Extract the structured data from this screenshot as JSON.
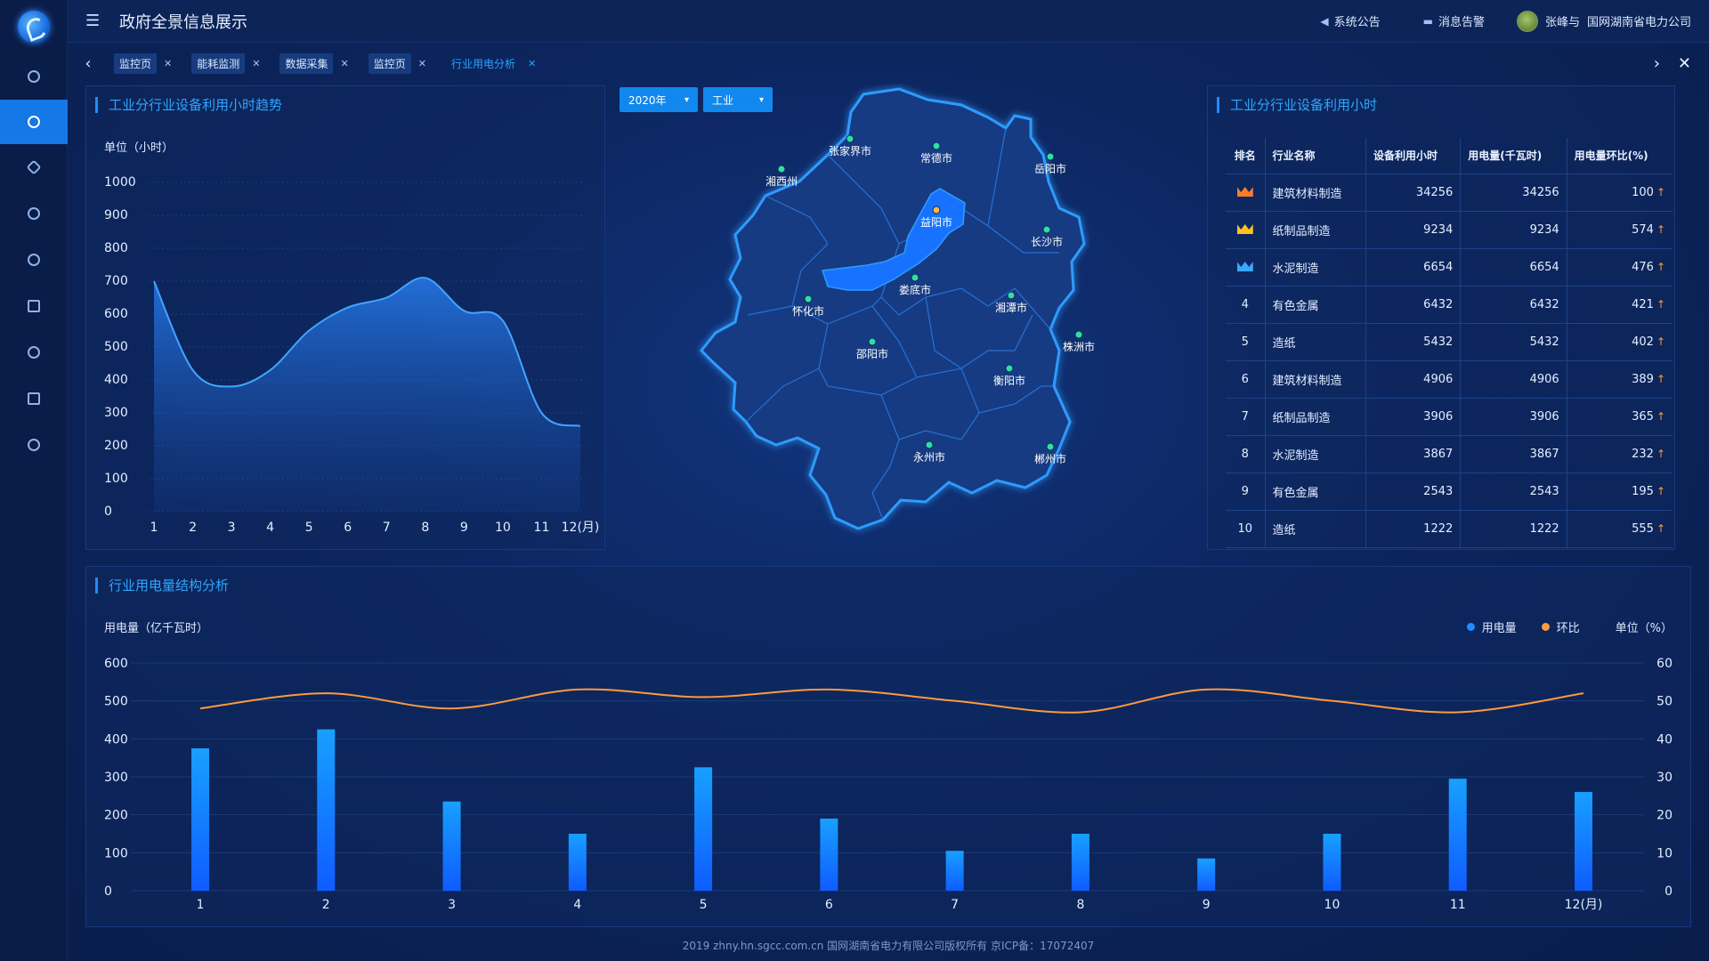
{
  "header": {
    "title": "政府全景信息展示",
    "announcement": "系统公告",
    "alerts": "消息告警",
    "user": "张峰与",
    "company": "国网湖南省电力公司"
  },
  "tabs": [
    {
      "label": "监控页"
    },
    {
      "label": "能耗监测"
    },
    {
      "label": "数据采集"
    },
    {
      "label": "监控页"
    },
    {
      "label": "行业用电分析",
      "active": true
    }
  ],
  "trend_panel": {
    "title": "工业分行业设备利用小时趋势",
    "unit": "单位（小时）"
  },
  "filters": {
    "year": "2020年",
    "industry": "工业"
  },
  "map": {
    "cities": [
      "张家界市",
      "常德市",
      "岳阳市",
      "湘西州",
      "益阳市",
      "长沙市",
      "娄底市",
      "湘潭市",
      "怀化市",
      "株洲市",
      "邵阳市",
      "衡阳市",
      "永州市",
      "郴州市"
    ],
    "highlighted": "益阳市"
  },
  "rank_panel": {
    "title": "工业分行业设备利用小时",
    "columns": [
      "排名",
      "行业名称",
      "设备利用小时",
      "用电量(千瓦时)",
      "用电量环比(%)"
    ],
    "rows": [
      {
        "rank": "1",
        "name": "建筑材料制造",
        "hours": "34256",
        "power": "34256",
        "ratio": "100"
      },
      {
        "rank": "2",
        "name": "纸制品制造",
        "hours": "9234",
        "power": "9234",
        "ratio": "574"
      },
      {
        "rank": "3",
        "name": "水泥制造",
        "hours": "6654",
        "power": "6654",
        "ratio": "476"
      },
      {
        "rank": "4",
        "name": "有色金属",
        "hours": "6432",
        "power": "6432",
        "ratio": "421"
      },
      {
        "rank": "5",
        "name": "造纸",
        "hours": "5432",
        "power": "5432",
        "ratio": "402"
      },
      {
        "rank": "6",
        "name": "建筑材料制造",
        "hours": "4906",
        "power": "4906",
        "ratio": "389"
      },
      {
        "rank": "7",
        "name": "纸制品制造",
        "hours": "3906",
        "power": "3906",
        "ratio": "365"
      },
      {
        "rank": "8",
        "name": "水泥制造",
        "hours": "3867",
        "power": "3867",
        "ratio": "232"
      },
      {
        "rank": "9",
        "name": "有色金属",
        "hours": "2543",
        "power": "2543",
        "ratio": "195"
      },
      {
        "rank": "10",
        "name": "造纸",
        "hours": "1222",
        "power": "1222",
        "ratio": "555"
      }
    ],
    "medal_colors": [
      "#ff7a2a",
      "#ffc21a",
      "#3aa8ff"
    ],
    "up_arrow": "↑"
  },
  "structure_panel": {
    "title": "行业用电量结构分析",
    "left_unit": "用电量（亿千瓦时）",
    "right_unit": "单位（%）",
    "legend_power": "用电量",
    "legend_ratio": "环比"
  },
  "footer": "2019 zhny.hn.sgcc.com.cn 国网湖南省电力有限公司版权所有 京ICP备：17072407",
  "colors": {
    "accent": "#1f8cff",
    "bar": "#1e7bff",
    "line_orange": "#ff9a3c",
    "area_line": "#3fa6ff"
  },
  "chart_data": [
    {
      "type": "area",
      "x": [
        "1",
        "2",
        "3",
        "4",
        "5",
        "6",
        "7",
        "8",
        "9",
        "10",
        "11",
        "12(月)"
      ],
      "values": [
        700,
        430,
        380,
        430,
        550,
        620,
        650,
        710,
        610,
        580,
        300,
        260
      ],
      "ylim": [
        0,
        1000
      ],
      "yticks": [
        "0",
        "100",
        "200",
        "300",
        "400",
        "500",
        "600",
        "700",
        "800",
        "900",
        "1000"
      ]
    },
    {
      "type": "bar",
      "categories": [
        "1",
        "2",
        "3",
        "4",
        "5",
        "6",
        "7",
        "8",
        "9",
        "10",
        "11",
        "12(月)"
      ],
      "series": [
        {
          "name": "用电量",
          "values": [
            375,
            425,
            235,
            150,
            325,
            190,
            105,
            150,
            85,
            150,
            295,
            260
          ]
        },
        {
          "name": "环比",
          "values": [
            48,
            52,
            48,
            53,
            51,
            53,
            50,
            47,
            53,
            50,
            47,
            52
          ]
        }
      ],
      "ylim": [
        0,
        600
      ],
      "y2lim": [
        0,
        60
      ],
      "yticks": [
        "0",
        "100",
        "200",
        "300",
        "400",
        "500",
        "600"
      ],
      "y2ticks": [
        "0",
        "10",
        "20",
        "30",
        "40",
        "50",
        "60"
      ]
    }
  ]
}
